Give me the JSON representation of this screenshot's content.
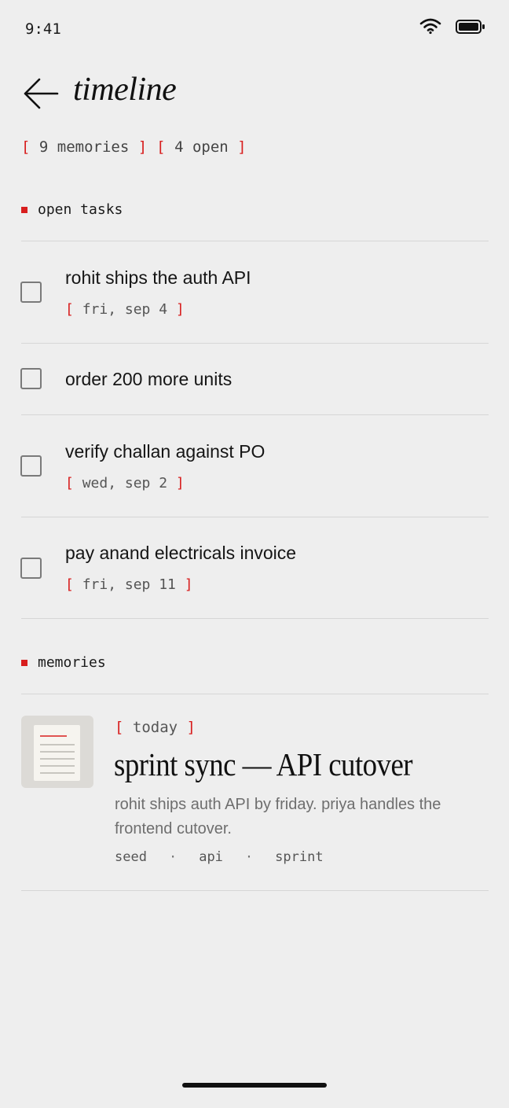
{
  "status_bar": {
    "time": "9:41",
    "icons": [
      "wifi-icon",
      "battery-icon"
    ]
  },
  "header": {
    "title": "timeline",
    "back_icon": "arrow-left-icon"
  },
  "summary": {
    "memories_count": "9 memories",
    "open_count": "4 open"
  },
  "open_tasks": {
    "heading": "open tasks",
    "items": [
      {
        "title": "rohit ships the auth API",
        "due": "fri, sep 4",
        "done": false
      },
      {
        "title": "order 200 more units",
        "due": "",
        "done": false
      },
      {
        "title": "verify challan against PO",
        "due": "wed, sep 2",
        "done": false
      },
      {
        "title": "pay anand electricals invoice",
        "due": "fri, sep 11",
        "done": false
      }
    ]
  },
  "memories": {
    "heading": "memories",
    "items": [
      {
        "date": "today",
        "title": "sprint sync — API cutover",
        "summary": "rohit ships auth API by friday. priya handles the frontend cutover.",
        "tags": [
          "seed",
          "api",
          "sprint"
        ],
        "thumb_icon": "document-icon"
      }
    ]
  },
  "colors": {
    "background": "#eeeeee",
    "accent": "#d81e1e",
    "text": "#1a1a1a",
    "muted": "#6e6e6e",
    "divider": "#d6d6d6"
  }
}
